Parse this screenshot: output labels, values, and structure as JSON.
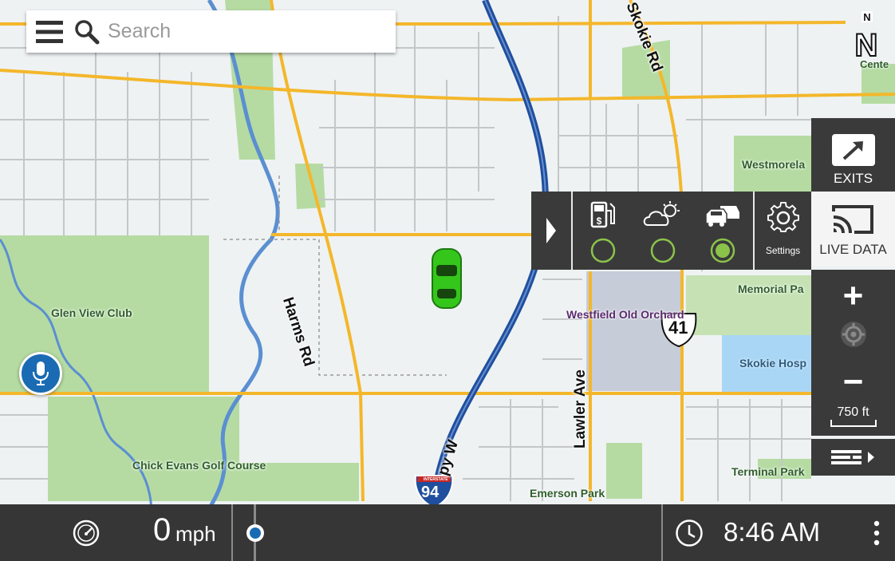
{
  "search": {
    "placeholder": "Search"
  },
  "compass": {
    "letter": "N"
  },
  "side_panel": {
    "exits_label": "EXITS",
    "live_data_label": "LIVE DATA",
    "zoom_in_symbol": "+",
    "zoom_out_symbol": "−",
    "scale_label": "750 ft"
  },
  "live_data_popup": {
    "settings_label": "Settings",
    "toggles": [
      {
        "icon": "fuel-price-icon",
        "selected": false
      },
      {
        "icon": "weather-icon",
        "selected": false
      },
      {
        "icon": "traffic-icon",
        "selected": true
      }
    ]
  },
  "map": {
    "labels": {
      "glen_view_club": "Glen View Club",
      "chick_evans": "Chick Evans Golf Course",
      "harms_rd": "Harms Rd",
      "skokie_rd": "Skokie Rd",
      "lawler_ave": "Lawler Ave",
      "westfield": "Westfield Old Orchard",
      "westmoreland": "Westmorela",
      "memorial_park": "Memorial Pa",
      "skokie_hospital": "Skokie Hosp",
      "terminal_park": "Terminal Park",
      "emerson_park": "Emerson Park",
      "edens_expy": "py W",
      "center": "Cente",
      "us_route": "41",
      "interstate": "94",
      "interstate_word": "INTERSTATE"
    }
  },
  "bottom_bar": {
    "speed": "0",
    "speed_unit": "mph",
    "time": "8:46 AM"
  },
  "colors": {
    "arterial": "#f4b72b",
    "expressway": "#1f4f9e",
    "park": "#b5dba2",
    "water": "#5b8fd1",
    "car": "#35c61c",
    "panel": "#3a3a3a",
    "accent_green": "#8bc34a"
  }
}
